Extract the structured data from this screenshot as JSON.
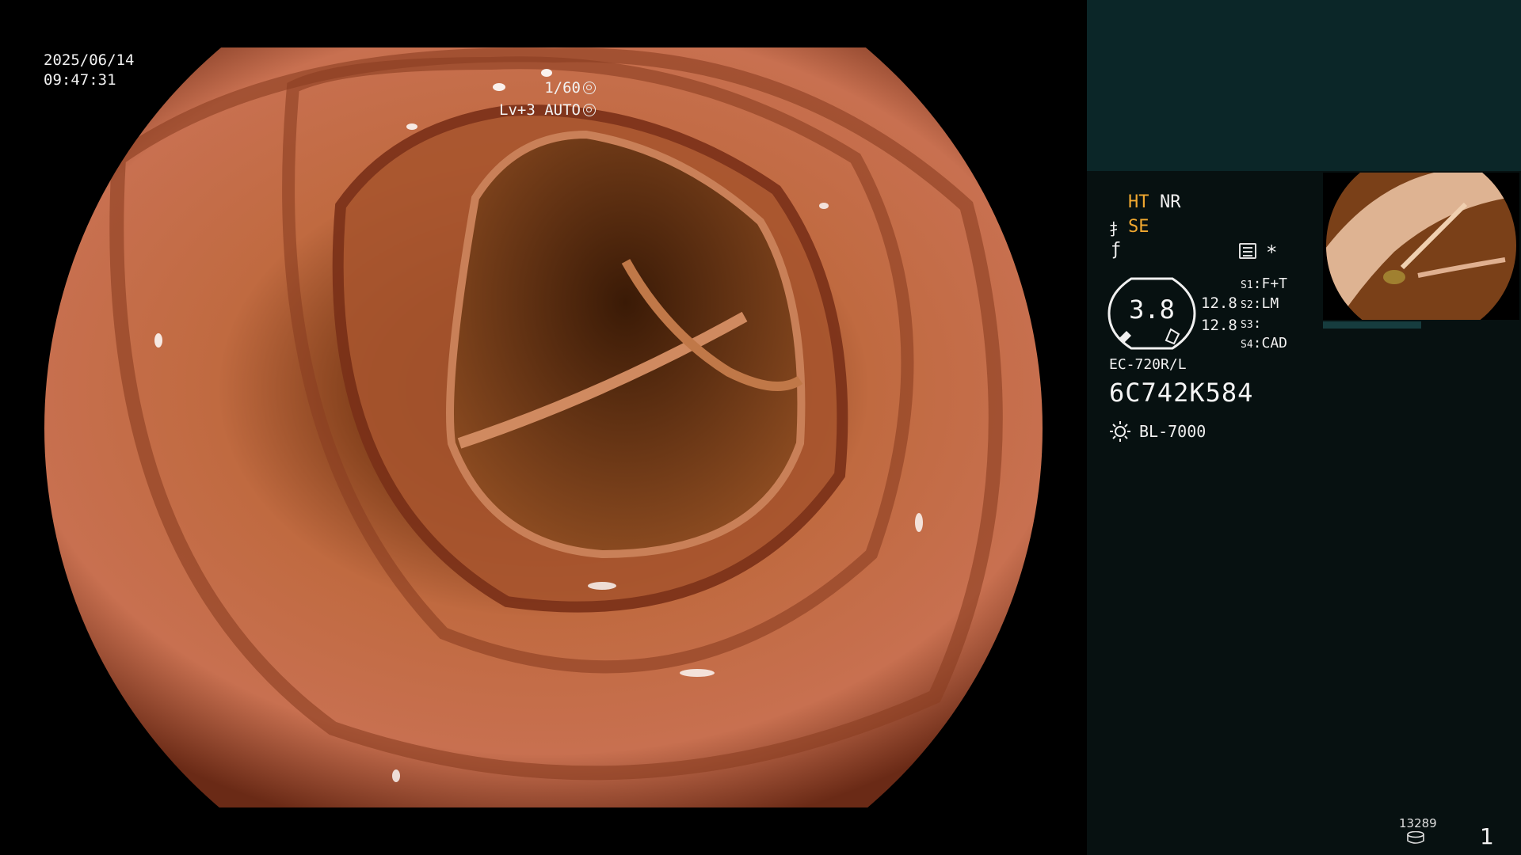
{
  "overlay": {
    "date": "2025/06/14",
    "time": "09:47:31",
    "shutter": "1/60",
    "level": "Lv+3 AUTO"
  },
  "panel": {
    "ht": "HT",
    "nr": "NR",
    "se": "SE",
    "gauge_value": "3.8",
    "value_1": "12.8",
    "value_2": "12.8",
    "slots": [
      {
        "key": "S1",
        "value": "F+T"
      },
      {
        "key": "S2",
        "value": "LM"
      },
      {
        "key": "S3",
        "value": ""
      },
      {
        "key": "S4",
        "value": "CAD"
      }
    ],
    "scope_model": "EC-720R/L",
    "scope_serial": "6C742K584",
    "light_source": "BL-7000",
    "image_count": "13289",
    "page_number": "1",
    "thumbnail_caption": "6C742K584"
  },
  "colors": {
    "accent": "#f0a830",
    "panel_top": "#0b2628",
    "panel_body": "#071111",
    "tissue": "#b8633c"
  },
  "icons": {
    "shutter": "aperture-icon",
    "level": "auto-iris-icon",
    "se": "structure-icon",
    "string": "enhance-icon",
    "menu": "menu-icon",
    "star": "asterisk-icon",
    "lamp": "lamp-icon",
    "disk": "storage-icon"
  }
}
